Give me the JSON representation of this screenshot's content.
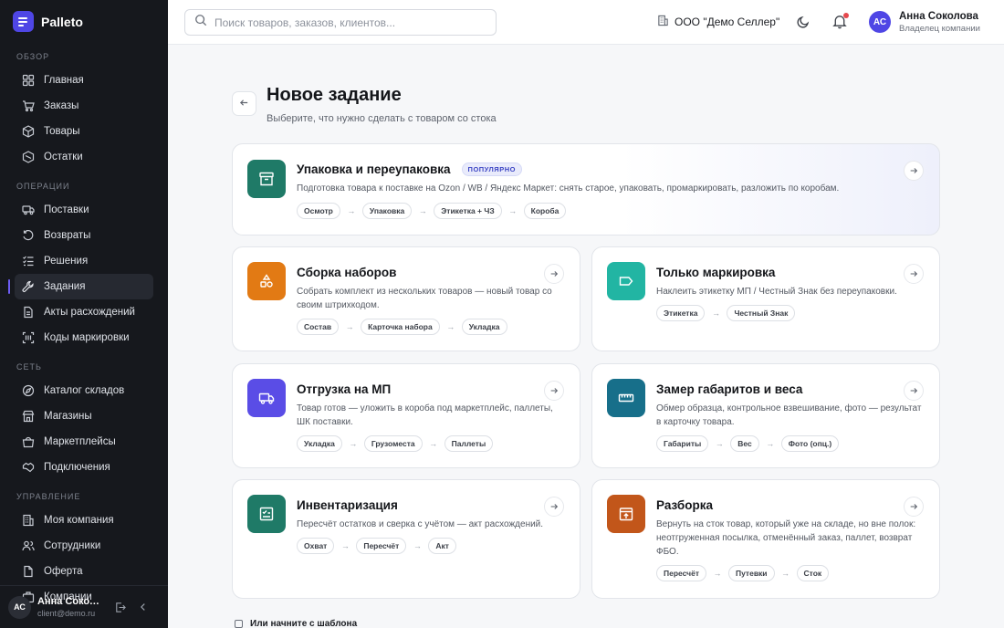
{
  "app": {
    "name": "Palleto"
  },
  "sidebar": {
    "sections": [
      {
        "title": "ОБЗОР",
        "items": [
          {
            "label": "Главная",
            "icon": "dashboard-icon"
          },
          {
            "label": "Заказы",
            "icon": "cart-icon"
          },
          {
            "label": "Товары",
            "icon": "box-icon"
          },
          {
            "label": "Остатки",
            "icon": "stock-icon"
          }
        ]
      },
      {
        "title": "ОПЕРАЦИИ",
        "items": [
          {
            "label": "Поставки",
            "icon": "truck-icon"
          },
          {
            "label": "Возвраты",
            "icon": "return-icon"
          },
          {
            "label": "Решения",
            "icon": "list-check-icon"
          },
          {
            "label": "Задания",
            "icon": "wrench-icon",
            "active": true
          },
          {
            "label": "Акты расхождений",
            "icon": "document-icon"
          },
          {
            "label": "Коды маркировки",
            "icon": "barcode-icon"
          }
        ]
      },
      {
        "title": "СЕТЬ",
        "items": [
          {
            "label": "Каталог складов",
            "icon": "compass-icon"
          },
          {
            "label": "Магазины",
            "icon": "store-icon"
          },
          {
            "label": "Маркетплейсы",
            "icon": "marketplace-icon"
          },
          {
            "label": "Подключения",
            "icon": "handshake-icon"
          }
        ]
      },
      {
        "title": "УПРАВЛЕНИЕ",
        "items": [
          {
            "label": "Моя компания",
            "icon": "building-icon"
          },
          {
            "label": "Сотрудники",
            "icon": "users-icon"
          },
          {
            "label": "Оферта",
            "icon": "file-icon"
          },
          {
            "label": "Компании",
            "icon": "companies-icon"
          }
        ]
      }
    ],
    "footer": {
      "avatar": "АС",
      "name": "Анна Сокол...",
      "email": "client@demo.ru"
    }
  },
  "header": {
    "search_placeholder": "Поиск товаров, заказов, клиентов...",
    "org": "ООО \"Демо Селлер\"",
    "user": {
      "avatar": "АС",
      "name": "Анна Соколова",
      "role": "Владелец компании"
    }
  },
  "page": {
    "title": "Новое задание",
    "subtitle": "Выберите, что нужно сделать с товаром со стока",
    "template_link": "Или начните с шаблона"
  },
  "cards": {
    "packing": {
      "title": "Упаковка и переупаковка",
      "badge": "ПОПУЛЯРНО",
      "desc": "Подготовка товара к поставке на Ozon / WB / Яндекс Маркет: снять старое, упаковать, промаркировать, разложить по коробам.",
      "steps": [
        "Осмотр",
        "Упаковка",
        "Этикетка + ЧЗ",
        "Короба"
      ],
      "color": "#1f7a67"
    },
    "kits": {
      "title": "Сборка наборов",
      "desc": "Собрать комплект из нескольких товаров — новый товар со своим штрихкодом.",
      "steps": [
        "Состав",
        "Карточка набора",
        "Укладка"
      ],
      "color": "#e27a14"
    },
    "labeling": {
      "title": "Только маркировка",
      "desc": "Наклеить этикетку МП / Честный Знак без переупаковки.",
      "steps": [
        "Этикетка",
        "Честный Знак"
      ],
      "color": "#22b5a3"
    },
    "shipment": {
      "title": "Отгрузка на МП",
      "desc": "Товар готов — уложить в короба под маркетплейс, паллеты, ШК поставки.",
      "steps": [
        "Укладка",
        "Грузоместа",
        "Паллеты"
      ],
      "color": "#5a4de6"
    },
    "measure": {
      "title": "Замер габаритов и веса",
      "desc": "Обмер образца, контрольное взвешивание, фото — результат в карточку товара.",
      "steps": [
        "Габариты",
        "Вес",
        "Фото (опц.)"
      ],
      "color": "#176f8a"
    },
    "inventory": {
      "title": "Инвентаризация",
      "desc": "Пересчёт остатков и сверка с учётом — акт расхождений.",
      "steps": [
        "Охват",
        "Пересчёт",
        "Акт"
      ],
      "color": "#1f7a67"
    },
    "disassembly": {
      "title": "Разборка",
      "desc": "Вернуть на сток товар, который уже на складе, но вне полок: неотгруженная посылка, отменённый заказ, паллет, возврат ФБО.",
      "steps": [
        "Пересчёт",
        "Путевки",
        "Сток"
      ],
      "color": "#c2561a"
    }
  }
}
